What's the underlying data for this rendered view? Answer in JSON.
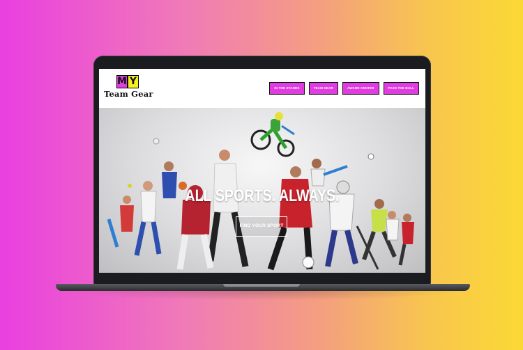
{
  "site": {
    "logo": {
      "letter_m": "M",
      "letter_y": "Y",
      "text": "Team Gear"
    },
    "nav": [
      {
        "label": "IN THE STANDS"
      },
      {
        "label": "TEAM GEAR"
      },
      {
        "label": "AWARD CENTER"
      },
      {
        "label": "PASS THE BALL"
      }
    ],
    "hero": {
      "title": "ALL SPORTS. ALWAYS.",
      "cta_label": "FIND YOUR SPORT"
    }
  },
  "colors": {
    "accent": "#e03ce0",
    "logo_yellow": "#f5ee22",
    "background_left": "#e93fe0",
    "background_right": "#fbd935"
  }
}
